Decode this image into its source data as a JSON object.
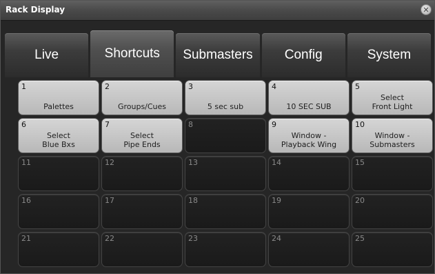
{
  "window": {
    "title": "Rack Display"
  },
  "tabs": [
    {
      "label": "Live"
    },
    {
      "label": "Shortcuts"
    },
    {
      "label": "Submasters"
    },
    {
      "label": "Config"
    },
    {
      "label": "System"
    }
  ],
  "active_tab": "Shortcuts",
  "keys": [
    {
      "number": "1",
      "label": "Palettes"
    },
    {
      "number": "2",
      "label": "Groups/Cues"
    },
    {
      "number": "3",
      "label": "5 sec sub"
    },
    {
      "number": "4",
      "label": "10 SEC SUB"
    },
    {
      "number": "5",
      "label": "Select\nFront Light"
    },
    {
      "number": "6",
      "label": "Select\nBlue Bxs"
    },
    {
      "number": "7",
      "label": "Select\nPipe Ends"
    },
    {
      "number": "8",
      "label": ""
    },
    {
      "number": "9",
      "label": "Window -\nPlayback Wing"
    },
    {
      "number": "10",
      "label": "Window -\nSubmasters"
    },
    {
      "number": "11",
      "label": ""
    },
    {
      "number": "12",
      "label": ""
    },
    {
      "number": "13",
      "label": ""
    },
    {
      "number": "14",
      "label": ""
    },
    {
      "number": "15",
      "label": ""
    },
    {
      "number": "16",
      "label": ""
    },
    {
      "number": "17",
      "label": ""
    },
    {
      "number": "18",
      "label": ""
    },
    {
      "number": "19",
      "label": ""
    },
    {
      "number": "20",
      "label": ""
    },
    {
      "number": "21",
      "label": ""
    },
    {
      "number": "22",
      "label": ""
    },
    {
      "number": "23",
      "label": ""
    },
    {
      "number": "24",
      "label": ""
    },
    {
      "number": "25",
      "label": ""
    }
  ],
  "colors": {
    "key_filled": "#c8c8c8",
    "key_empty": "#1e1e1e",
    "window_bg": "#262626"
  },
  "icons": {
    "close": "close-icon"
  }
}
